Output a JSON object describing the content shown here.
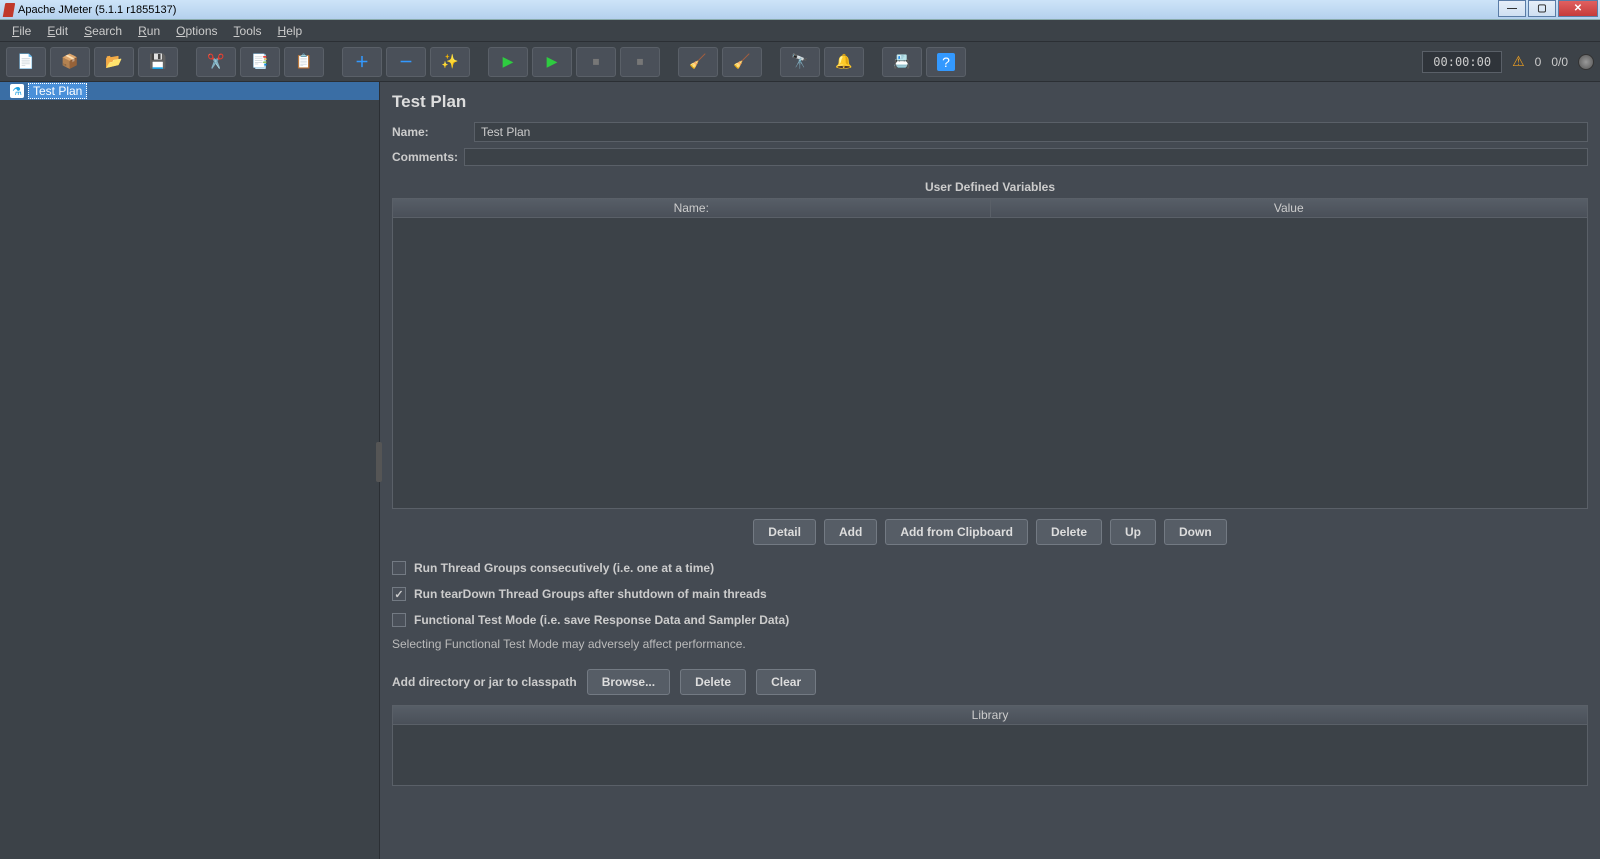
{
  "window": {
    "title": "Apache JMeter (5.1.1 r1855137)"
  },
  "menu": {
    "file": "File",
    "edit": "Edit",
    "search": "Search",
    "run": "Run",
    "options": "Options",
    "tools": "Tools",
    "help": "Help"
  },
  "toolbar_status": {
    "timer": "00:00:00",
    "warn_count": "0",
    "thread_ratio": "0/0"
  },
  "tree": {
    "root_label": "Test Plan"
  },
  "panel": {
    "title": "Test Plan",
    "name_label": "Name:",
    "name_value": "Test Plan",
    "comments_label": "Comments:",
    "udv_title": "User Defined Variables",
    "col_name": "Name:",
    "col_value": "Value",
    "buttons": {
      "detail": "Detail",
      "add": "Add",
      "add_clip": "Add from Clipboard",
      "delete": "Delete",
      "up": "Up",
      "down": "Down"
    },
    "chk_consecutive": "Run Thread Groups consecutively (i.e. one at a time)",
    "chk_teardown": "Run tearDown Thread Groups after shutdown of main threads",
    "chk_functional": "Functional Test Mode (i.e. save Response Data and Sampler Data)",
    "note": "Selecting Functional Test Mode may adversely affect performance.",
    "classpath_label": "Add directory or jar to classpath",
    "browse": "Browse...",
    "cp_delete": "Delete",
    "clear": "Clear",
    "library_header": "Library"
  }
}
